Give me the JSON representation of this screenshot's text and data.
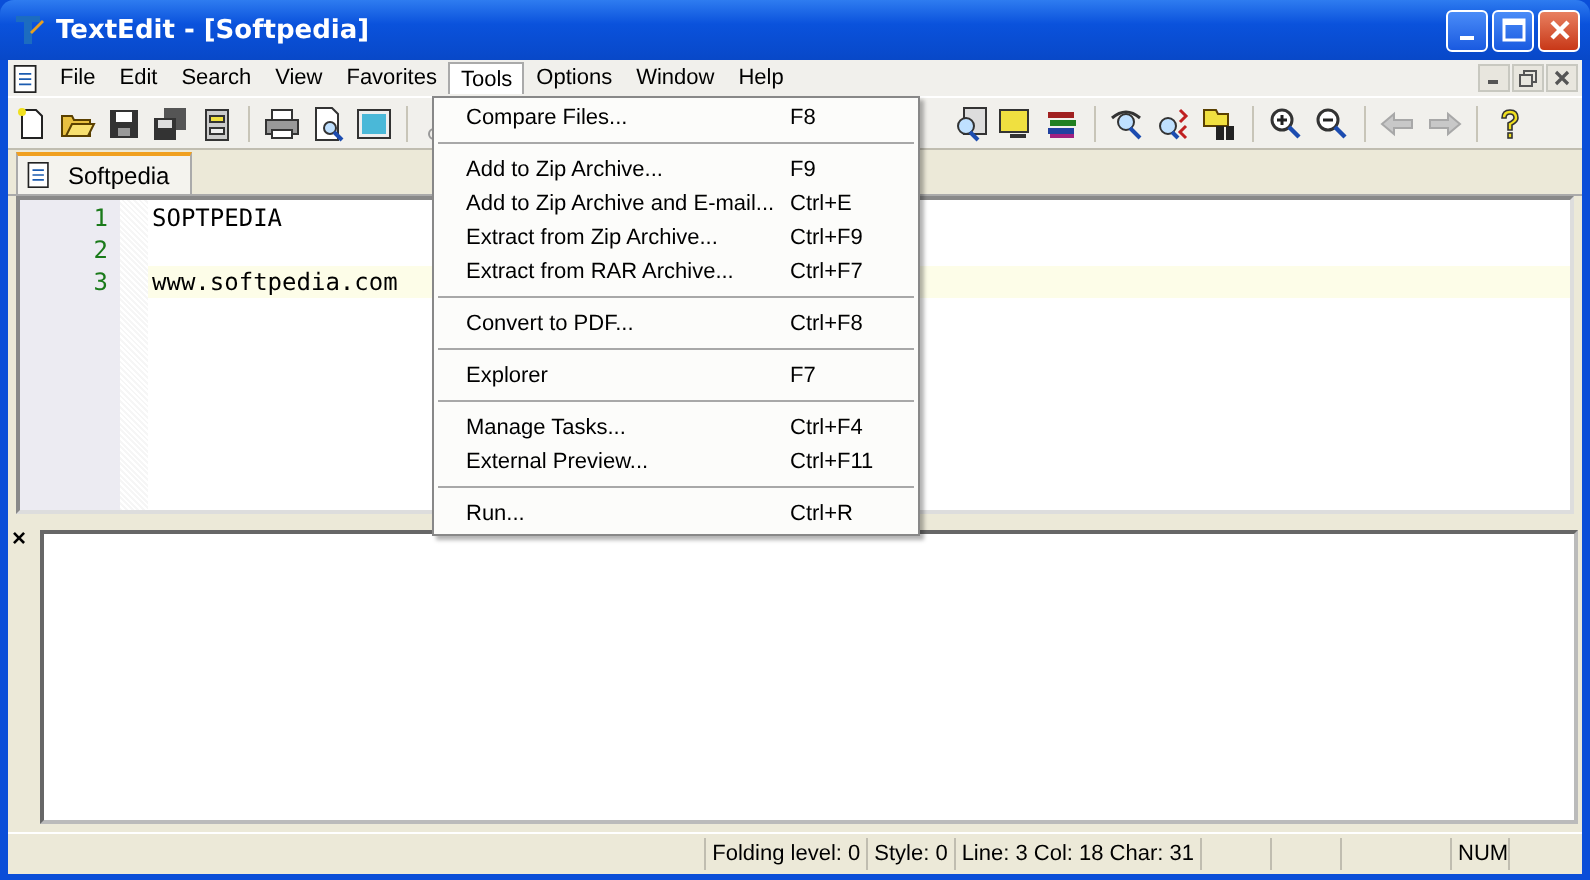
{
  "window": {
    "title": "TextEdit - [Softpedia]"
  },
  "menu_bar": [
    {
      "label": "File",
      "selected": false
    },
    {
      "label": "Edit",
      "selected": false
    },
    {
      "label": "Search",
      "selected": false
    },
    {
      "label": "View",
      "selected": false
    },
    {
      "label": "Favorites",
      "selected": false
    },
    {
      "label": "Tools",
      "selected": true
    },
    {
      "label": "Options",
      "selected": false
    },
    {
      "label": "Window",
      "selected": false
    },
    {
      "label": "Help",
      "selected": false
    }
  ],
  "history_buttons": [
    {
      "disabled": true
    },
    {
      "disabled": true
    }
  ],
  "tabs": [
    {
      "label": "Softpedia",
      "selected": true
    }
  ],
  "editor": {
    "lines": [
      {
        "number": "1",
        "text": "SOPTPEDIA",
        "current": false
      },
      {
        "number": "2",
        "current": false
      },
      {
        "number": "3",
        "text": "www.softpedia.com",
        "current": true
      }
    ]
  },
  "tools_menu": [
    {
      "kind": "item",
      "label": "Compare Files...",
      "shortcut": "F8"
    },
    {
      "kind": "separator"
    },
    {
      "kind": "item",
      "label": "Add to Zip Archive...",
      "shortcut": "F9"
    },
    {
      "kind": "item",
      "label": "Add to Zip Archive and E-mail...",
      "shortcut": "Ctrl+E"
    },
    {
      "kind": "item",
      "label": "Extract from Zip Archive...",
      "shortcut": "Ctrl+F9"
    },
    {
      "kind": "item",
      "label": "Extract from RAR Archive...",
      "shortcut": "Ctrl+F7"
    },
    {
      "kind": "separator"
    },
    {
      "kind": "item",
      "label": "Convert to PDF...",
      "shortcut": "Ctrl+F8"
    },
    {
      "kind": "separator"
    },
    {
      "kind": "item",
      "label": "Explorer",
      "shortcut": "F7"
    },
    {
      "kind": "separator"
    },
    {
      "kind": "item",
      "label": "Manage Tasks...",
      "shortcut": "Ctrl+F4"
    },
    {
      "kind": "item",
      "label": "External Preview...",
      "shortcut": "Ctrl+F11"
    },
    {
      "kind": "separator"
    },
    {
      "kind": "item",
      "label": "Run...",
      "shortcut": "Ctrl+R"
    }
  ],
  "output_pane": {
    "close": "×"
  },
  "status_bar": [
    "Folding level: 0",
    "Style: 0",
    "Line: 3 Col: 18 Char: 31",
    "NUM"
  ]
}
